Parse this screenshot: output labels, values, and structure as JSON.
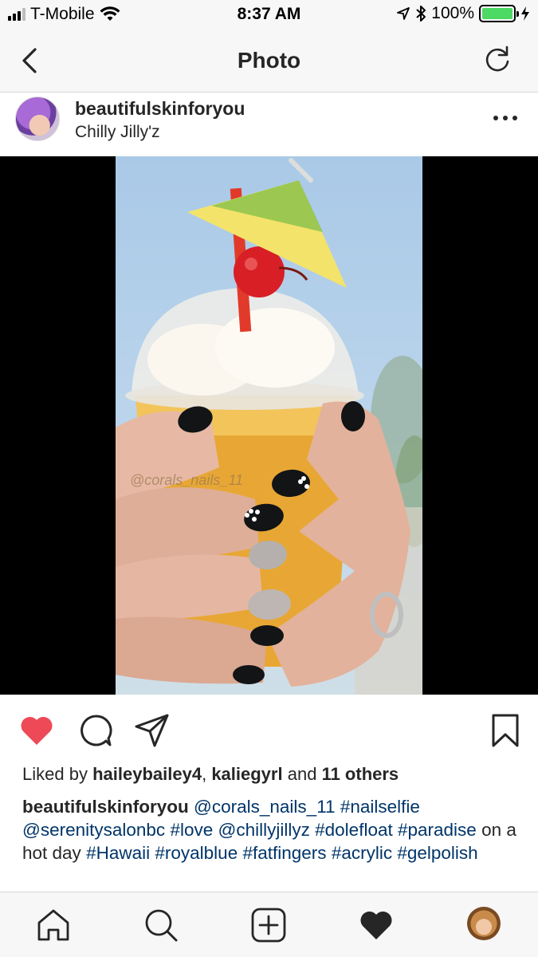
{
  "status_bar": {
    "carrier": "T-Mobile",
    "time": "8:37 AM",
    "battery": "100%"
  },
  "nav": {
    "title": "Photo"
  },
  "post": {
    "username": "beautifulskinforyou",
    "location": "Chilly Jilly'z",
    "watermark": "@corals_nails_11"
  },
  "likes": {
    "prefix": "Liked by",
    "user1": "haileybailey4",
    "separator": ",",
    "user2": "kaliegyrl",
    "and": "and",
    "others": "11 others"
  },
  "caption": {
    "username": "beautifulskinforyou",
    "tokens": [
      {
        "text": "@corals_nails_11",
        "tag": true
      },
      {
        "text": "#nailselfie",
        "tag": true
      },
      {
        "text": "@serenitysalonbc",
        "tag": true
      },
      {
        "text": "#love",
        "tag": true
      },
      {
        "text": "@chillyjillyz",
        "tag": true
      },
      {
        "text": "#dolefloat",
        "tag": true
      },
      {
        "text": "#paradise",
        "tag": true
      },
      {
        "text": "on a hot day",
        "tag": false
      },
      {
        "text": "#Hawaii",
        "tag": true
      },
      {
        "text": "#royalblue",
        "tag": true
      },
      {
        "text": "#fatfingers",
        "tag": true
      },
      {
        "text": "#acrylic",
        "tag": true
      },
      {
        "text": "#gelpolish",
        "tag": true
      }
    ]
  },
  "colors": {
    "like_active": "#ed4956",
    "tag": "#003569",
    "battery": "#4cd964"
  },
  "icons": {
    "back": "chevron-left-icon",
    "refresh": "refresh-icon",
    "more": "more-horizontal-icon",
    "like": "heart-icon",
    "comment": "comment-icon",
    "share": "share-icon",
    "save": "bookmark-icon",
    "home": "home-icon",
    "search": "search-icon",
    "add": "add-post-icon",
    "activity": "activity-heart-icon"
  }
}
